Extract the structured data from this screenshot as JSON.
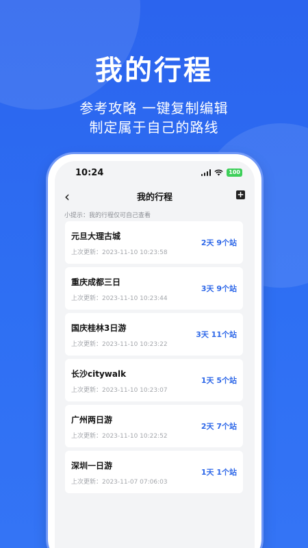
{
  "promo": {
    "title": "我的行程",
    "subtitle_line1": "参考攻略 一键复制编辑",
    "subtitle_line2": "制定属于自己的路线"
  },
  "status_bar": {
    "time": "10:24",
    "battery": "100",
    "icons": [
      "signal-icon",
      "wifi-icon",
      "battery-icon"
    ]
  },
  "nav": {
    "back_icon": "chevron-left-icon",
    "title": "我的行程",
    "add_icon": "plus-square-icon"
  },
  "tip": "小提示：我的行程仅可自己查看",
  "trips": [
    {
      "name": "元旦大理古城",
      "updated": "上次更新：2023-11-10 10:23:58",
      "stats": "2天 9个站"
    },
    {
      "name": "重庆成都三日",
      "updated": "上次更新：2023-11-10 10:23:44",
      "stats": "3天 9个站"
    },
    {
      "name": "国庆桂林3日游",
      "updated": "上次更新：2023-11-10 10:23:22",
      "stats": "3天 11个站"
    },
    {
      "name": "长沙citywalk",
      "updated": "上次更新：2023-11-10 10:23:07",
      "stats": "1天 5个站"
    },
    {
      "name": "广州两日游",
      "updated": "上次更新：2023-11-10 10:22:52",
      "stats": "2天 7个站"
    },
    {
      "name": "深圳一日游",
      "updated": "上次更新：2023-11-07 07:06:03",
      "stats": "1天 1个站"
    }
  ],
  "colors": {
    "brand_blue": "#2d67e8",
    "background_blue": "#2f6ff0",
    "battery_green": "#3ecf5a"
  }
}
